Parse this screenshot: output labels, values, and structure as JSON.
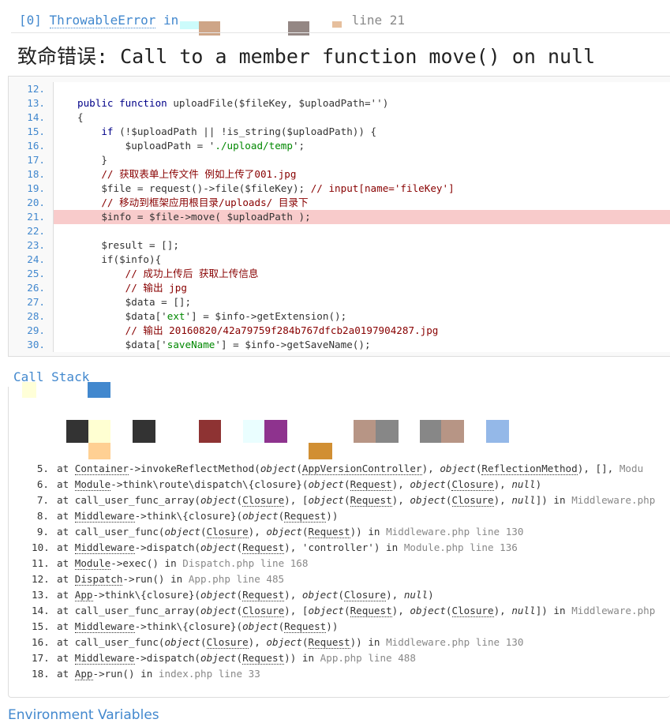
{
  "exception": {
    "index": "[0]",
    "class": "ThrowableError",
    "in": " in",
    "line_label": "line 21"
  },
  "title": "致命错误: Call to a member function move() on null",
  "code": [
    {
      "n": "12.",
      "seg": []
    },
    {
      "n": "13.",
      "seg": [
        {
          "k": "kw",
          "t": "public function"
        },
        {
          "k": "p",
          "t": " uploadFile($fileKey, $uploadPath='')"
        }
      ]
    },
    {
      "n": "14.",
      "seg": [
        {
          "k": "p",
          "t": "{"
        }
      ]
    },
    {
      "n": "15.",
      "seg": [
        {
          "k": "p",
          "t": "    "
        },
        {
          "k": "kw",
          "t": "if"
        },
        {
          "k": "p",
          "t": " (!$uploadPath || !is_string($uploadPath)) {"
        }
      ]
    },
    {
      "n": "16.",
      "seg": [
        {
          "k": "p",
          "t": "        $uploadPath = '"
        },
        {
          "k": "str",
          "t": "./upload/temp"
        },
        {
          "k": "p",
          "t": "';"
        }
      ]
    },
    {
      "n": "17.",
      "seg": [
        {
          "k": "p",
          "t": "    }"
        }
      ]
    },
    {
      "n": "18.",
      "seg": [
        {
          "k": "cmt",
          "t": "    // 获取表单上传文件 例如上传了001.jpg"
        }
      ]
    },
    {
      "n": "19.",
      "seg": [
        {
          "k": "p",
          "t": "    $file = request()->file($fileKey); "
        },
        {
          "k": "cmt",
          "t": "// input[name='fileKey']"
        }
      ]
    },
    {
      "n": "20.",
      "seg": [
        {
          "k": "cmt",
          "t": "    // 移动到框架应用根目录/uploads/ 目录下"
        }
      ]
    },
    {
      "n": "21.",
      "hl": true,
      "seg": [
        {
          "k": "p",
          "t": "    $info = $file->move( $uploadPath );"
        }
      ]
    },
    {
      "n": "22.",
      "seg": []
    },
    {
      "n": "23.",
      "seg": [
        {
          "k": "p",
          "t": "    $result = [];"
        }
      ]
    },
    {
      "n": "24.",
      "seg": [
        {
          "k": "p",
          "t": "    if($info){"
        }
      ]
    },
    {
      "n": "25.",
      "seg": [
        {
          "k": "cmt",
          "t": "        // 成功上传后 获取上传信息"
        }
      ]
    },
    {
      "n": "26.",
      "seg": [
        {
          "k": "cmt",
          "t": "        // 输出 jpg"
        }
      ]
    },
    {
      "n": "27.",
      "seg": [
        {
          "k": "p",
          "t": "        $data = [];"
        }
      ]
    },
    {
      "n": "28.",
      "seg": [
        {
          "k": "p",
          "t": "        $data['"
        },
        {
          "k": "str",
          "t": "ext"
        },
        {
          "k": "p",
          "t": "'] = $info->getExtension();"
        }
      ]
    },
    {
      "n": "29.",
      "seg": [
        {
          "k": "cmt",
          "t": "        // 输出 20160820/42a79759f284b767dfcb2a0197904287.jpg"
        }
      ]
    },
    {
      "n": "30.",
      "seg": [
        {
          "k": "p",
          "t": "        $data['"
        },
        {
          "k": "str",
          "t": "saveName"
        },
        {
          "k": "p",
          "t": "'] = $info->getSaveName();"
        }
      ]
    }
  ],
  "call_stack_title": "Call Stack",
  "stack": [
    {
      "n": "5.",
      "seg": [
        {
          "k": "p",
          "t": "at "
        },
        {
          "k": "c",
          "t": "Container"
        },
        {
          "k": "p",
          "t": "->invokeReflectMethod("
        },
        {
          "k": "e",
          "t": "object"
        },
        {
          "k": "p",
          "t": "("
        },
        {
          "k": "c",
          "t": "AppVersionController"
        },
        {
          "k": "p",
          "t": "), "
        },
        {
          "k": "e",
          "t": "object"
        },
        {
          "k": "p",
          "t": "("
        },
        {
          "k": "c",
          "t": "ReflectionMethod"
        },
        {
          "k": "p",
          "t": "), [],"
        },
        {
          "k": "f",
          "t": "      Modu"
        }
      ]
    },
    {
      "n": "6.",
      "seg": [
        {
          "k": "p",
          "t": "at "
        },
        {
          "k": "c",
          "t": "Module"
        },
        {
          "k": "p",
          "t": "->think\\route\\dispatch\\{closure}("
        },
        {
          "k": "e",
          "t": "object"
        },
        {
          "k": "p",
          "t": "("
        },
        {
          "k": "c",
          "t": "Request"
        },
        {
          "k": "p",
          "t": "), "
        },
        {
          "k": "e",
          "t": "object"
        },
        {
          "k": "p",
          "t": "("
        },
        {
          "k": "c",
          "t": "Closure"
        },
        {
          "k": "p",
          "t": "), "
        },
        {
          "k": "e",
          "t": "null"
        },
        {
          "k": "p",
          "t": ")"
        }
      ]
    },
    {
      "n": "7.",
      "seg": [
        {
          "k": "p",
          "t": "at call_user_func_array("
        },
        {
          "k": "e",
          "t": "object"
        },
        {
          "k": "p",
          "t": "("
        },
        {
          "k": "c",
          "t": "Closure"
        },
        {
          "k": "p",
          "t": "), ["
        },
        {
          "k": "e",
          "t": "object"
        },
        {
          "k": "p",
          "t": "("
        },
        {
          "k": "c",
          "t": "Request"
        },
        {
          "k": "p",
          "t": "), "
        },
        {
          "k": "e",
          "t": "object"
        },
        {
          "k": "p",
          "t": "("
        },
        {
          "k": "c",
          "t": "Closure"
        },
        {
          "k": "p",
          "t": "), "
        },
        {
          "k": "e",
          "t": "null"
        },
        {
          "k": "p",
          "t": "]) in "
        },
        {
          "k": "f",
          "t": "Middleware.php"
        }
      ]
    },
    {
      "n": "8.",
      "seg": [
        {
          "k": "p",
          "t": "at "
        },
        {
          "k": "c",
          "t": "Middleware"
        },
        {
          "k": "p",
          "t": "->think\\{closure}("
        },
        {
          "k": "e",
          "t": "object"
        },
        {
          "k": "p",
          "t": "("
        },
        {
          "k": "c",
          "t": "Request"
        },
        {
          "k": "p",
          "t": "))"
        }
      ]
    },
    {
      "n": "9.",
      "seg": [
        {
          "k": "p",
          "t": "at call_user_func("
        },
        {
          "k": "e",
          "t": "object"
        },
        {
          "k": "p",
          "t": "("
        },
        {
          "k": "c",
          "t": "Closure"
        },
        {
          "k": "p",
          "t": "), "
        },
        {
          "k": "e",
          "t": "object"
        },
        {
          "k": "p",
          "t": "("
        },
        {
          "k": "c",
          "t": "Request"
        },
        {
          "k": "p",
          "t": ")) in "
        },
        {
          "k": "f",
          "t": "Middleware.php line 130"
        }
      ]
    },
    {
      "n": "10.",
      "seg": [
        {
          "k": "p",
          "t": "at "
        },
        {
          "k": "c",
          "t": "Middleware"
        },
        {
          "k": "p",
          "t": "->dispatch("
        },
        {
          "k": "e",
          "t": "object"
        },
        {
          "k": "p",
          "t": "("
        },
        {
          "k": "c",
          "t": "Request"
        },
        {
          "k": "p",
          "t": "), 'controller') in "
        },
        {
          "k": "f",
          "t": "Module.php line 136"
        }
      ]
    },
    {
      "n": "11.",
      "seg": [
        {
          "k": "p",
          "t": "at "
        },
        {
          "k": "c",
          "t": "Module"
        },
        {
          "k": "p",
          "t": "->exec() in "
        },
        {
          "k": "f",
          "t": "Dispatch.php line 168"
        }
      ]
    },
    {
      "n": "12.",
      "seg": [
        {
          "k": "p",
          "t": "at "
        },
        {
          "k": "c",
          "t": "Dispatch"
        },
        {
          "k": "p",
          "t": "->run() in "
        },
        {
          "k": "f",
          "t": "App.php line 485"
        }
      ]
    },
    {
      "n": "13.",
      "seg": [
        {
          "k": "p",
          "t": "at "
        },
        {
          "k": "c",
          "t": "App"
        },
        {
          "k": "p",
          "t": "->think\\{closure}("
        },
        {
          "k": "e",
          "t": "object"
        },
        {
          "k": "p",
          "t": "("
        },
        {
          "k": "c",
          "t": "Request"
        },
        {
          "k": "p",
          "t": "), "
        },
        {
          "k": "e",
          "t": "object"
        },
        {
          "k": "p",
          "t": "("
        },
        {
          "k": "c",
          "t": "Closure"
        },
        {
          "k": "p",
          "t": "), "
        },
        {
          "k": "e",
          "t": "null"
        },
        {
          "k": "p",
          "t": ")"
        }
      ]
    },
    {
      "n": "14.",
      "seg": [
        {
          "k": "p",
          "t": "at call_user_func_array("
        },
        {
          "k": "e",
          "t": "object"
        },
        {
          "k": "p",
          "t": "("
        },
        {
          "k": "c",
          "t": "Closure"
        },
        {
          "k": "p",
          "t": "), ["
        },
        {
          "k": "e",
          "t": "object"
        },
        {
          "k": "p",
          "t": "("
        },
        {
          "k": "c",
          "t": "Request"
        },
        {
          "k": "p",
          "t": "), "
        },
        {
          "k": "e",
          "t": "object"
        },
        {
          "k": "p",
          "t": "("
        },
        {
          "k": "c",
          "t": "Closure"
        },
        {
          "k": "p",
          "t": "), "
        },
        {
          "k": "e",
          "t": "null"
        },
        {
          "k": "p",
          "t": "]) in "
        },
        {
          "k": "f",
          "t": "Middleware.php"
        }
      ]
    },
    {
      "n": "15.",
      "seg": [
        {
          "k": "p",
          "t": "at "
        },
        {
          "k": "c",
          "t": "Middleware"
        },
        {
          "k": "p",
          "t": "->think\\{closure}("
        },
        {
          "k": "e",
          "t": "object"
        },
        {
          "k": "p",
          "t": "("
        },
        {
          "k": "c",
          "t": "Request"
        },
        {
          "k": "p",
          "t": "))"
        }
      ]
    },
    {
      "n": "16.",
      "seg": [
        {
          "k": "p",
          "t": "at call_user_func("
        },
        {
          "k": "e",
          "t": "object"
        },
        {
          "k": "p",
          "t": "("
        },
        {
          "k": "c",
          "t": "Closure"
        },
        {
          "k": "p",
          "t": "), "
        },
        {
          "k": "e",
          "t": "object"
        },
        {
          "k": "p",
          "t": "("
        },
        {
          "k": "c",
          "t": "Request"
        },
        {
          "k": "p",
          "t": ")) in "
        },
        {
          "k": "f",
          "t": "Middleware.php line 130"
        }
      ]
    },
    {
      "n": "17.",
      "seg": [
        {
          "k": "p",
          "t": "at "
        },
        {
          "k": "c",
          "t": "Middleware"
        },
        {
          "k": "p",
          "t": "->dispatch("
        },
        {
          "k": "e",
          "t": "object"
        },
        {
          "k": "p",
          "t": "("
        },
        {
          "k": "c",
          "t": "Request"
        },
        {
          "k": "p",
          "t": ")) in "
        },
        {
          "k": "f",
          "t": "App.php line 488"
        }
      ]
    },
    {
      "n": "18.",
      "seg": [
        {
          "k": "p",
          "t": "at "
        },
        {
          "k": "c",
          "t": "App"
        },
        {
          "k": "p",
          "t": "->run() in "
        },
        {
          "k": "f",
          "t": "index.php line 33"
        }
      ]
    }
  ],
  "environment_title": "Environment Variables",
  "colors": {
    "accent": "#4288ce",
    "highlight": "#f8cbcb",
    "keyword": "#000088",
    "string": "#008800",
    "comment": "#880000"
  }
}
